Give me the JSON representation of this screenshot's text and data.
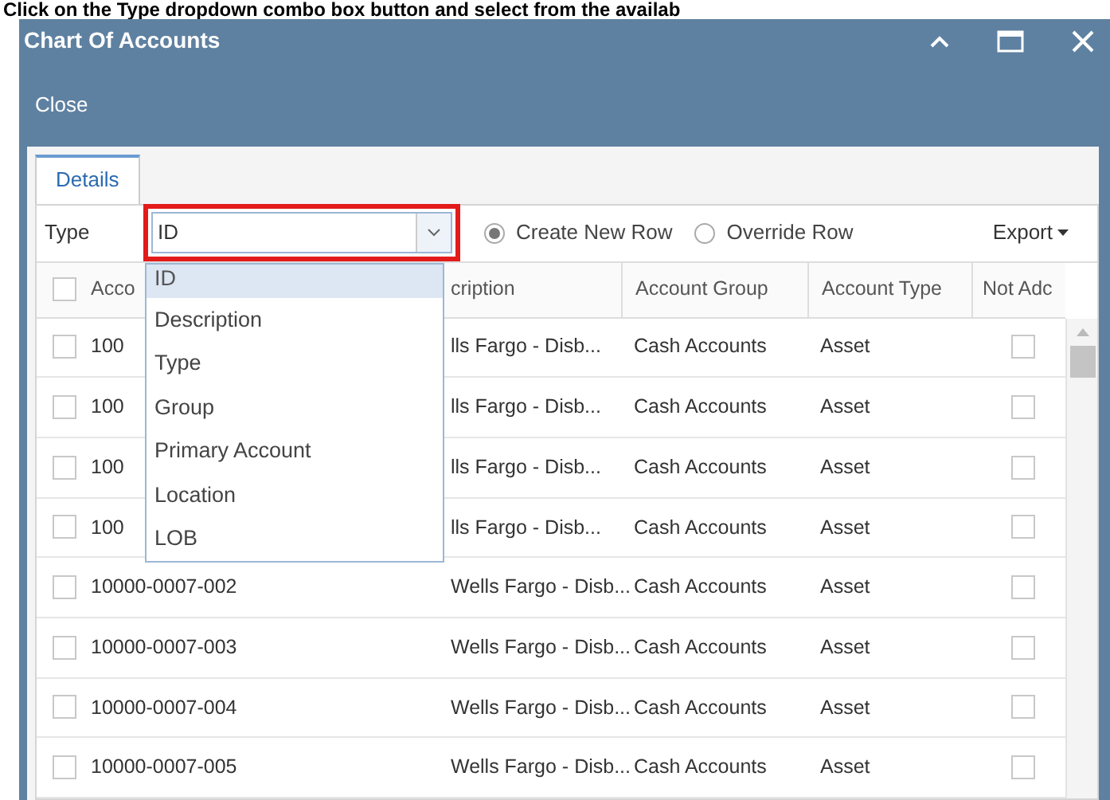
{
  "instruction": "Click on the **Type dropdown combo box button** and select from the availab",
  "window": {
    "title": "Chart Of Accounts"
  },
  "toolbar": {
    "buttons": [
      "Close"
    ]
  },
  "tabs": [
    {
      "label": "Details",
      "selected": true
    }
  ],
  "filter": {
    "label": "Type",
    "value": "ID",
    "expanded": true,
    "options": [
      {
        "label": "ID",
        "selected": true
      },
      {
        "label": "Description",
        "selected": false
      },
      {
        "label": "Type",
        "selected": false
      },
      {
        "label": "Group",
        "selected": false
      },
      {
        "label": "Primary Account",
        "selected": false
      },
      {
        "label": "Location",
        "selected": false
      },
      {
        "label": "LOB",
        "selected": false
      }
    ]
  },
  "radios": [
    {
      "label": "Create New Row",
      "selected": true
    },
    {
      "label": "Override Row",
      "selected": false
    }
  ],
  "export": "Export",
  "table": {
    "header_checked": false,
    "columns": [
      "Acco",
      "cription",
      "Account Group",
      "Account Type",
      "Not Adc"
    ],
    "rows": [
      {
        "checked": false,
        "account": "100",
        "description": "lls Fargo - Disb...",
        "group": "Cash Accounts",
        "type": "Asset",
        "not_add": false
      },
      {
        "checked": false,
        "account": "100",
        "description": "lls Fargo - Disb...",
        "group": "Cash Accounts",
        "type": "Asset",
        "not_add": false
      },
      {
        "checked": false,
        "account": "100",
        "description": "lls Fargo - Disb...",
        "group": "Cash Accounts",
        "type": "Asset",
        "not_add": false
      },
      {
        "checked": false,
        "account": "100",
        "description": "lls Fargo - Disb...",
        "group": "Cash Accounts",
        "type": "Asset",
        "not_add": false
      },
      {
        "checked": false,
        "account": "10000-0007-002",
        "description": "Wells Fargo - Disb...",
        "group": "Cash Accounts",
        "type": "Asset",
        "not_add": false
      },
      {
        "checked": false,
        "account": "10000-0007-003",
        "description": "Wells Fargo - Disb...",
        "group": "Cash Accounts",
        "type": "Asset",
        "not_add": false
      },
      {
        "checked": false,
        "account": "10000-0007-004",
        "description": "Wells Fargo - Disb...",
        "group": "Cash Accounts",
        "type": "Asset",
        "not_add": false
      },
      {
        "checked": false,
        "account": "10000-0007-005",
        "description": "Wells Fargo - Disb...",
        "group": "Cash Accounts",
        "type": "Asset",
        "not_add": false
      }
    ]
  }
}
